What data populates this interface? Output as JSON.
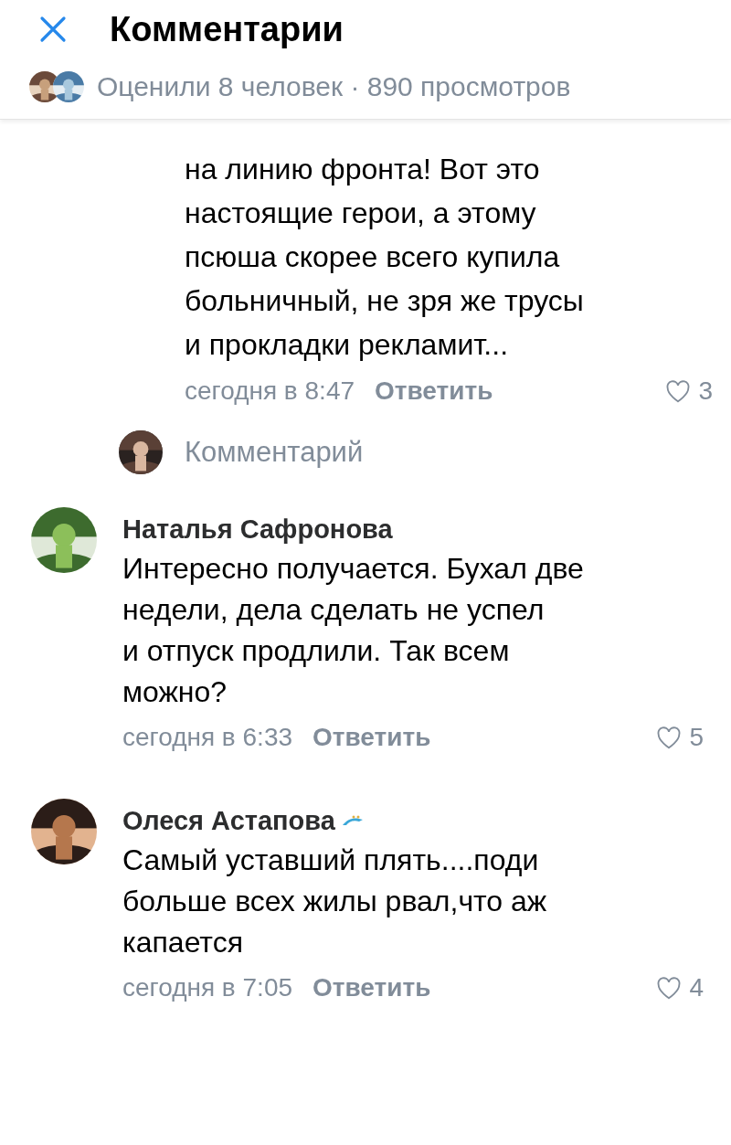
{
  "header": {
    "title": "Комментарии"
  },
  "stats": {
    "text": "Оценили 8 человек · 890 просмотров"
  },
  "reply": {
    "text": "на линию фронта! Вот это\nнастоящие герои, а этому\nпсюша скорее всего купила\nбольничный, не зря же трусы\nи прокладки рекламит...",
    "time": "сегодня в 8:47",
    "action": "Ответить",
    "likes": "3"
  },
  "reply_input": {
    "placeholder": "Комментарий"
  },
  "comments": [
    {
      "author": "Наталья Сафронова",
      "badge": false,
      "text": "Интересно получается. Бухал две\nнедели, дела сделать не успел\nи отпуск продлили. Так всем\nможно?",
      "time": "сегодня в 6:33",
      "action": "Ответить",
      "likes": "5"
    },
    {
      "author": "Олеся Астапова",
      "badge": true,
      "text": "Самый уставший плять....поди\nбольше всех жилы рвал,что аж\nкапается",
      "time": "сегодня в 7:05",
      "action": "Ответить",
      "likes": "4"
    }
  ]
}
